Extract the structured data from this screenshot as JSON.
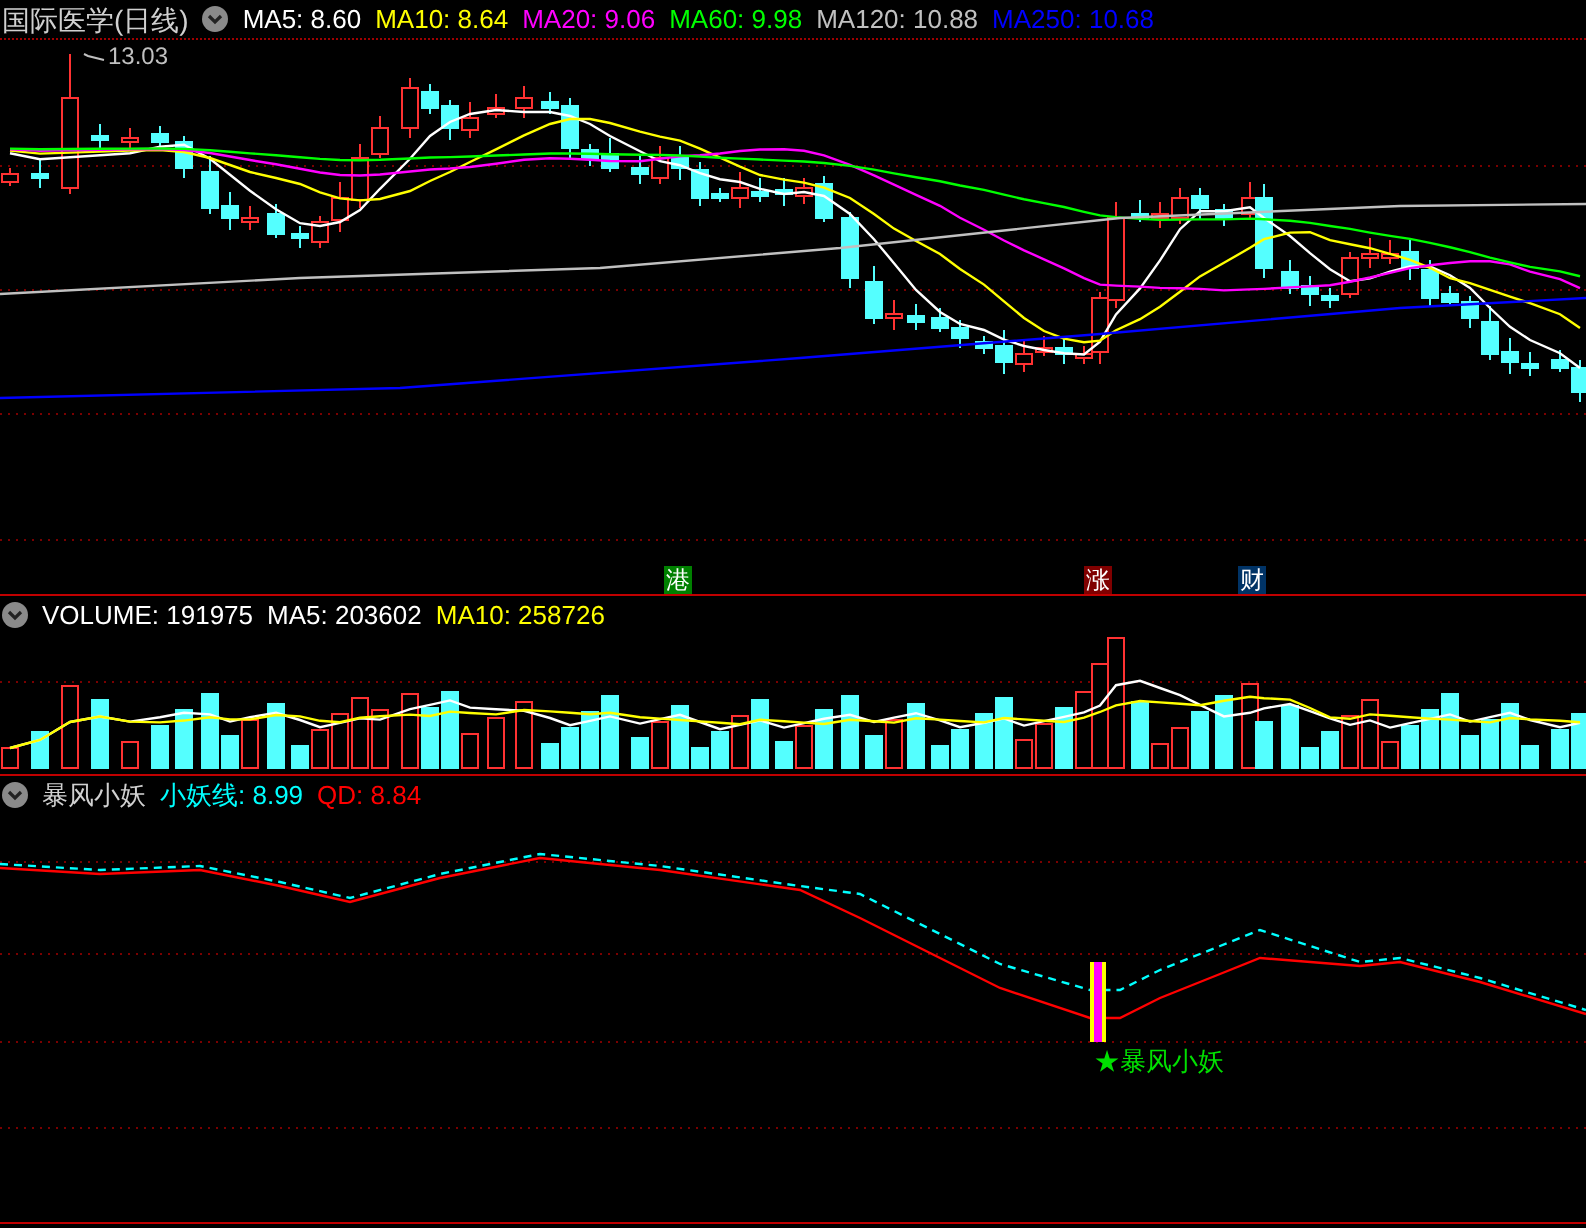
{
  "price_panel": {
    "title": "国际医学(日线)",
    "indicators": [
      {
        "label": "MA5: 8.60",
        "color": "#ffffff"
      },
      {
        "label": "MA10: 8.64",
        "color": "#ffff00"
      },
      {
        "label": "MA20: 9.06",
        "color": "#ff00ff"
      },
      {
        "label": "MA60: 9.98",
        "color": "#00ff00"
      },
      {
        "label": "MA120: 10.88",
        "color": "#c0c0c0"
      },
      {
        "label": "MA250: 10.68",
        "color": "#0000ff"
      }
    ],
    "high_label": "13.03",
    "markers": [
      {
        "text": "港",
        "color": "#008000"
      },
      {
        "text": "涨",
        "color": "#800000"
      },
      {
        "text": "财",
        "color": "#003366"
      }
    ]
  },
  "volume_panel": {
    "indicators": [
      {
        "label": "VOLUME: 191975",
        "color": "#ffffff"
      },
      {
        "label": "MA5: 203602",
        "color": "#ffffff"
      },
      {
        "label": "MA10: 258726",
        "color": "#ffff00"
      }
    ]
  },
  "indicator_panel": {
    "title": "暴风小妖",
    "indicators": [
      {
        "label": "小妖线: 8.99",
        "color": "#00ffff"
      },
      {
        "label": "QD: 8.84",
        "color": "#ff0000"
      }
    ],
    "signal_label": "★暴风小妖"
  }
}
